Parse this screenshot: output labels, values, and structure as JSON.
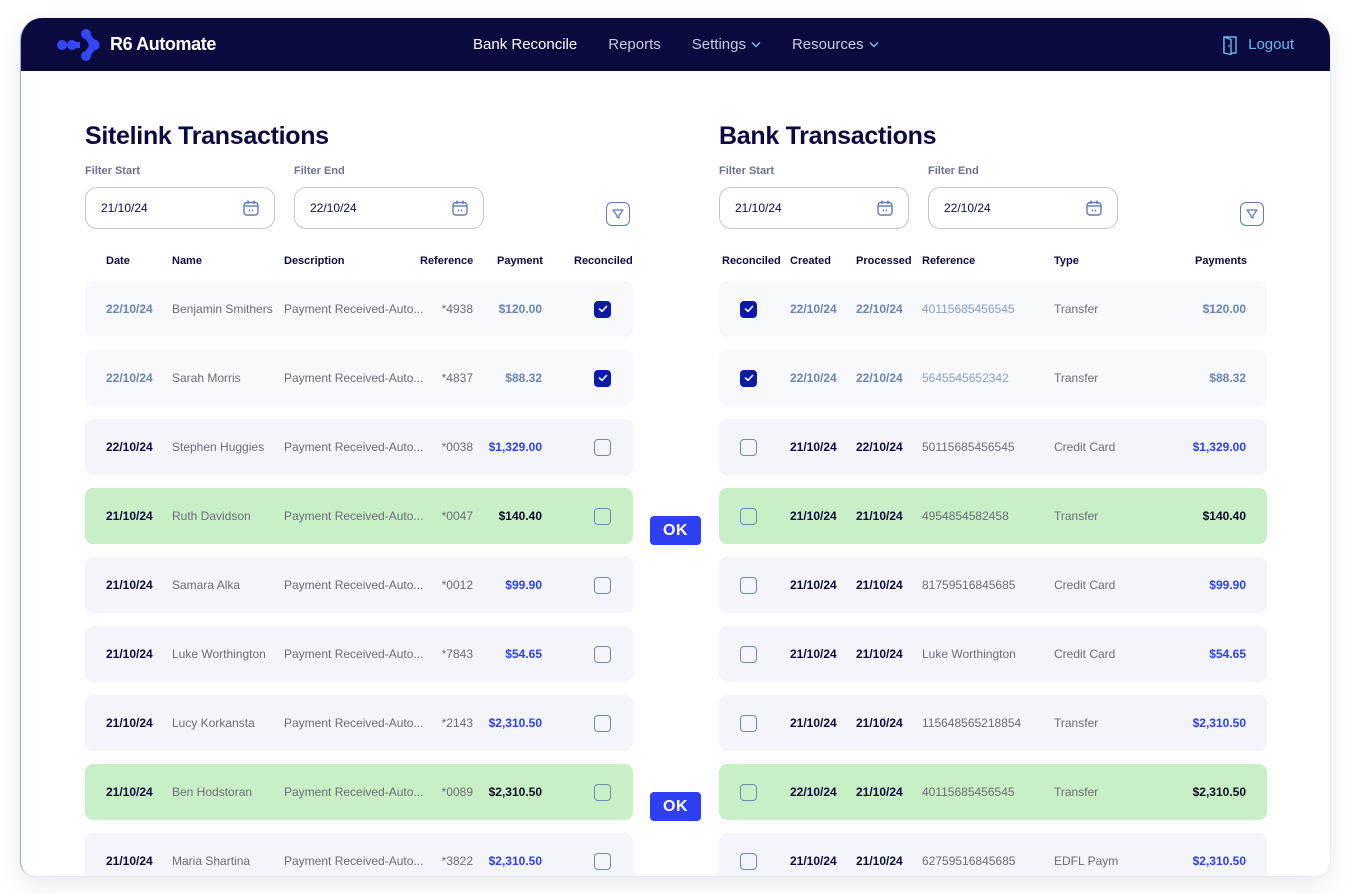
{
  "navbar": {
    "brand": "R6 Automate",
    "links": [
      {
        "label": "Bank Reconcile",
        "active": true,
        "dropdown": false
      },
      {
        "label": "Reports",
        "active": false,
        "dropdown": false
      },
      {
        "label": "Settings",
        "active": false,
        "dropdown": true
      },
      {
        "label": "Resources",
        "active": false,
        "dropdown": true
      }
    ],
    "logout_label": "Logout"
  },
  "colors": {
    "navbar_bg": "#0a0a3f",
    "accent_blue": "#2f3ff2",
    "checkbox_checked": "#0d1aa6",
    "match_row_bg": "#c9efc6",
    "row_bg": "#f3f5fa",
    "logout": "#6fb6f0"
  },
  "sitelink": {
    "title": "Sitelink Transactions",
    "filter_start_label": "Filter Start",
    "filter_start_value": "21/10/24",
    "filter_end_label": "Filter End",
    "filter_end_value": "22/10/24",
    "columns": [
      "Date",
      "Name",
      "Description",
      "Reference",
      "Payment",
      "Reconciled"
    ],
    "rows": [
      {
        "date": "22/10/24",
        "name": "Benjamin Smithers",
        "description": "Payment Received-Auto...",
        "reference": "*4938",
        "payment": "$120.00",
        "reconciled": true,
        "state": "done"
      },
      {
        "date": "22/10/24",
        "name": "Sarah Morris",
        "description": "Payment Received-Auto...",
        "reference": "*4837",
        "payment": "$88.32",
        "reconciled": true,
        "state": "done"
      },
      {
        "date": "22/10/24",
        "name": "Stephen Huggies",
        "description": "Payment Received-Auto...",
        "reference": "*0038",
        "payment": "$1,329.00",
        "reconciled": false,
        "state": "normal"
      },
      {
        "date": "21/10/24",
        "name": "Ruth Davidson",
        "description": "Payment Received-Auto...",
        "reference": "*0047",
        "payment": "$140.40",
        "reconciled": false,
        "state": "match"
      },
      {
        "date": "21/10/24",
        "name": "Samara Alka",
        "description": "Payment Received-Auto...",
        "reference": "*0012",
        "payment": "$99.90",
        "reconciled": false,
        "state": "normal"
      },
      {
        "date": "21/10/24",
        "name": "Luke Worthington",
        "description": "Payment Received-Auto...",
        "reference": "*7843",
        "payment": "$54.65",
        "reconciled": false,
        "state": "normal"
      },
      {
        "date": "21/10/24",
        "name": "Lucy Korkansta",
        "description": "Payment Received-Auto...",
        "reference": "*2143",
        "payment": "$2,310.50",
        "reconciled": false,
        "state": "normal"
      },
      {
        "date": "21/10/24",
        "name": "Ben Hodstoran",
        "description": "Payment Received-Auto...",
        "reference": "*0089",
        "payment": "$2,310.50",
        "reconciled": false,
        "state": "match"
      },
      {
        "date": "21/10/24",
        "name": "Maria Shartina",
        "description": "Payment Received-Auto...",
        "reference": "*3822",
        "payment": "$2,310.50",
        "reconciled": false,
        "state": "normal"
      }
    ]
  },
  "bank": {
    "title": "Bank Transactions",
    "filter_start_label": "Filter Start",
    "filter_start_value": "21/10/24",
    "filter_end_label": "Filter End",
    "filter_end_value": "22/10/24",
    "columns": [
      "Reconciled",
      "Created",
      "Processed",
      "Reference",
      "Type",
      "Payments"
    ],
    "rows": [
      {
        "reconciled": true,
        "created": "22/10/24",
        "processed": "22/10/24",
        "reference": "40115685456545",
        "type": "Transfer",
        "payment": "$120.00",
        "state": "done"
      },
      {
        "reconciled": true,
        "created": "22/10/24",
        "processed": "22/10/24",
        "reference": "5645545652342",
        "type": "Transfer",
        "payment": "$88.32",
        "state": "done"
      },
      {
        "reconciled": false,
        "created": "21/10/24",
        "processed": "22/10/24",
        "reference": "50115685456545",
        "type": "Credit Card",
        "payment": "$1,329.00",
        "state": "normal"
      },
      {
        "reconciled": false,
        "created": "21/10/24",
        "processed": "21/10/24",
        "reference": "4954854582458",
        "type": "Transfer",
        "payment": "$140.40",
        "state": "match"
      },
      {
        "reconciled": false,
        "created": "21/10/24",
        "processed": "21/10/24",
        "reference": "81759516845685",
        "type": "Credit Card",
        "payment": "$99.90",
        "state": "normal"
      },
      {
        "reconciled": false,
        "created": "21/10/24",
        "processed": "21/10/24",
        "reference": "Luke Worthington",
        "type": "Credit Card",
        "payment": "$54.65",
        "state": "normal"
      },
      {
        "reconciled": false,
        "created": "21/10/24",
        "processed": "21/10/24",
        "reference": "115648565218854",
        "type": "Transfer",
        "payment": "$2,310.50",
        "state": "normal"
      },
      {
        "reconciled": false,
        "created": "22/10/24",
        "processed": "21/10/24",
        "reference": "40115685456545",
        "type": "Transfer",
        "payment": "$2,310.50",
        "state": "match"
      },
      {
        "reconciled": false,
        "created": "21/10/24",
        "processed": "21/10/24",
        "reference": "62759516845685",
        "type": "EDFL Paym",
        "payment": "$2,310.50",
        "state": "normal"
      }
    ]
  },
  "ok_button_label": "OK"
}
